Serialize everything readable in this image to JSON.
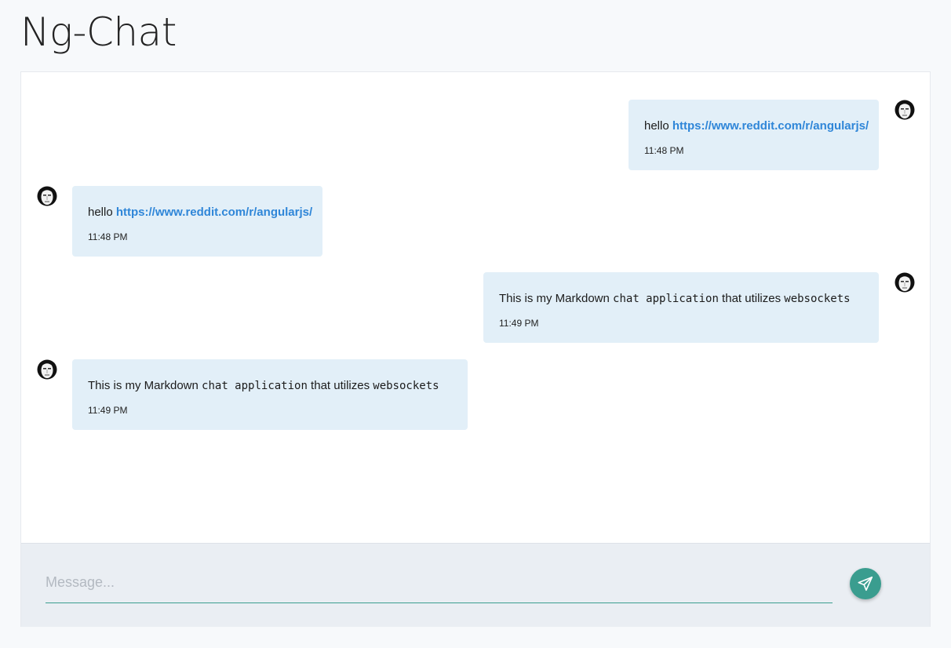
{
  "app": {
    "title": "Ng-Chat"
  },
  "colors": {
    "accent": "#3a9d8f",
    "bubble": "#e2eff8",
    "link": "#2f86d8"
  },
  "messages": [
    {
      "side": "right",
      "avatar": "user-avatar-icon",
      "parts": [
        {
          "type": "text",
          "value": "hello "
        },
        {
          "type": "link",
          "value": "https://www.reddit.com/r/angularjs/"
        }
      ],
      "time": "11:48 PM"
    },
    {
      "side": "left",
      "avatar": "user-avatar-icon",
      "parts": [
        {
          "type": "text",
          "value": "hello "
        },
        {
          "type": "link",
          "value": "https://www.reddit.com/r/angularjs/"
        }
      ],
      "time": "11:48 PM"
    },
    {
      "side": "right",
      "avatar": "user-avatar-icon",
      "parts": [
        {
          "type": "text",
          "value": "This is my Markdown "
        },
        {
          "type": "code",
          "value": "chat application"
        },
        {
          "type": "text",
          "value": " that utilizes "
        },
        {
          "type": "code",
          "value": "websockets"
        }
      ],
      "time": "11:49 PM"
    },
    {
      "side": "left",
      "avatar": "user-avatar-icon",
      "parts": [
        {
          "type": "text",
          "value": "This is my Markdown "
        },
        {
          "type": "code",
          "value": "chat application"
        },
        {
          "type": "text",
          "value": " that utilizes "
        },
        {
          "type": "code",
          "value": "websockets"
        }
      ],
      "time": "11:49 PM"
    }
  ],
  "composer": {
    "placeholder": "Message...",
    "value": "",
    "send_icon": "send-icon"
  }
}
